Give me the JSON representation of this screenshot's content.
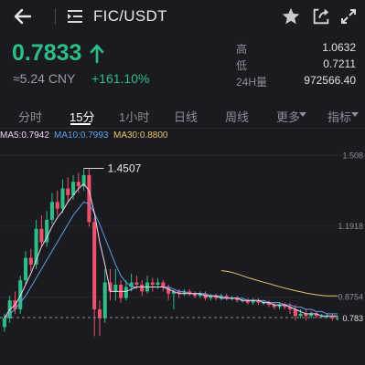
{
  "header": {
    "pair": "FIC/USDT",
    "icons": [
      "back-arrow-icon",
      "menu-list-icon",
      "star-icon",
      "share-icon",
      "expand-icon"
    ]
  },
  "ticker": {
    "price": "0.7833",
    "cny": "≈5.24 CNY",
    "change": "+161.10%",
    "stats": [
      {
        "label": "高",
        "value": "1.0632"
      },
      {
        "label": "低",
        "value": "0.7211"
      },
      {
        "label": "24H量",
        "value": "972566.40"
      }
    ]
  },
  "tabs": {
    "items": [
      "分时",
      "15分",
      "1小时",
      "日线",
      "周线",
      "更多",
      "指标"
    ],
    "active": "15分"
  },
  "ma": {
    "ma5": "MA5:0.7942",
    "ma10": "MA10:0.7993",
    "ma30": "MA30:0.8800"
  },
  "colors": {
    "up": "#2dbd85",
    "down": "#f0516b",
    "ma5": "#f4d3f2",
    "ma10": "#5ea0e6",
    "ma30": "#e7c36b",
    "background": "#1a1b20"
  },
  "chart_data": {
    "type": "candlestick",
    "y_ticks": [
      "1.508",
      "1.1918",
      "0.8754",
      "0.783"
    ],
    "annotations": {
      "high": "1.4507",
      "last": "0.783"
    },
    "ylim": [
      0.62,
      1.55
    ],
    "candles": [
      [
        0.74,
        0.78,
        0.72,
        0.8
      ],
      [
        0.78,
        0.86,
        0.76,
        0.88
      ],
      [
        0.86,
        0.82,
        0.8,
        0.9
      ],
      [
        0.82,
        0.95,
        0.8,
        0.97
      ],
      [
        0.95,
        1.05,
        0.93,
        1.08
      ],
      [
        1.05,
        1.02,
        0.99,
        1.09
      ],
      [
        1.02,
        1.18,
        1.0,
        1.22
      ],
      [
        1.18,
        1.12,
        1.1,
        1.24
      ],
      [
        1.12,
        1.22,
        1.1,
        1.26
      ],
      [
        1.22,
        1.3,
        1.2,
        1.34
      ],
      [
        1.3,
        1.27,
        1.24,
        1.35
      ],
      [
        1.27,
        1.36,
        1.25,
        1.4
      ],
      [
        1.36,
        1.33,
        1.3,
        1.41
      ],
      [
        1.33,
        1.39,
        1.31,
        1.42
      ],
      [
        1.39,
        1.37,
        1.34,
        1.43
      ],
      [
        1.37,
        1.42,
        1.35,
        1.45
      ],
      [
        1.42,
        1.21,
        1.19,
        1.45
      ],
      [
        1.21,
        0.82,
        0.7,
        1.23
      ],
      [
        0.82,
        0.78,
        0.7,
        0.86
      ],
      [
        0.78,
        0.94,
        0.76,
        1.0
      ],
      [
        0.94,
        0.9,
        0.86,
        1.0
      ],
      [
        0.9,
        0.93,
        0.86,
        1.0
      ],
      [
        0.93,
        0.87,
        0.85,
        0.95
      ],
      [
        0.87,
        0.92,
        0.86,
        0.95
      ],
      [
        0.92,
        0.94,
        0.9,
        0.98
      ],
      [
        0.94,
        0.93,
        0.91,
        0.97
      ],
      [
        0.93,
        0.9,
        0.88,
        0.95
      ],
      [
        0.9,
        0.94,
        0.89,
        0.97
      ],
      [
        0.94,
        0.93,
        0.9,
        0.96
      ],
      [
        0.93,
        0.94,
        0.91,
        0.96
      ],
      [
        0.94,
        0.92,
        0.9,
        0.95
      ],
      [
        0.92,
        0.89,
        0.86,
        0.93
      ],
      [
        0.89,
        0.9,
        0.82,
        0.91
      ],
      [
        0.9,
        0.89,
        0.87,
        0.91
      ],
      [
        0.89,
        0.9,
        0.88,
        0.91
      ],
      [
        0.9,
        0.89,
        0.88,
        0.91
      ],
      [
        0.89,
        0.88,
        0.87,
        0.9
      ],
      [
        0.88,
        0.89,
        0.87,
        0.9
      ],
      [
        0.89,
        0.87,
        0.86,
        0.9
      ],
      [
        0.87,
        0.88,
        0.86,
        0.89
      ],
      [
        0.88,
        0.87,
        0.86,
        0.89
      ],
      [
        0.87,
        0.88,
        0.86,
        0.89
      ],
      [
        0.88,
        0.87,
        0.86,
        0.89
      ],
      [
        0.87,
        0.87,
        0.86,
        0.88
      ],
      [
        0.87,
        0.86,
        0.85,
        0.88
      ],
      [
        0.86,
        0.86,
        0.85,
        0.87
      ],
      [
        0.86,
        0.85,
        0.84,
        0.87
      ],
      [
        0.85,
        0.86,
        0.84,
        0.87
      ],
      [
        0.86,
        0.85,
        0.84,
        0.87
      ],
      [
        0.85,
        0.85,
        0.84,
        0.86
      ],
      [
        0.85,
        0.84,
        0.83,
        0.86
      ],
      [
        0.84,
        0.83,
        0.82,
        0.85
      ],
      [
        0.83,
        0.84,
        0.82,
        0.85
      ],
      [
        0.84,
        0.83,
        0.82,
        0.85
      ],
      [
        0.83,
        0.82,
        0.8,
        0.85
      ],
      [
        0.82,
        0.79,
        0.77,
        0.84
      ],
      [
        0.79,
        0.8,
        0.78,
        0.82
      ],
      [
        0.8,
        0.79,
        0.77,
        0.82
      ],
      [
        0.79,
        0.8,
        0.78,
        0.81
      ],
      [
        0.8,
        0.79,
        0.78,
        0.81
      ],
      [
        0.79,
        0.79,
        0.78,
        0.8
      ],
      [
        0.79,
        0.79,
        0.78,
        0.8
      ],
      [
        0.79,
        0.78,
        0.77,
        0.8
      ],
      [
        0.78,
        0.78,
        0.77,
        0.79
      ]
    ],
    "ma5": [
      0.78,
      0.82,
      0.84,
      0.88,
      0.93,
      0.98,
      1.04,
      1.1,
      1.14,
      1.19,
      1.23,
      1.26,
      1.3,
      1.33,
      1.36,
      1.38,
      1.35,
      1.25,
      1.12,
      1.02,
      0.9,
      0.9,
      0.9,
      0.9,
      0.91,
      0.92,
      0.92,
      0.92,
      0.92,
      0.92,
      0.92,
      0.91,
      0.9,
      0.89,
      0.89,
      0.89,
      0.89,
      0.89,
      0.88,
      0.88,
      0.88,
      0.87,
      0.87,
      0.87,
      0.87,
      0.86,
      0.86,
      0.86,
      0.86,
      0.85,
      0.85,
      0.84,
      0.84,
      0.84,
      0.83,
      0.82,
      0.81,
      0.8,
      0.8,
      0.8,
      0.79,
      0.79,
      0.79,
      0.79
    ],
    "ma10": [
      0.78,
      0.8,
      0.82,
      0.85,
      0.88,
      0.92,
      0.96,
      1.0,
      1.04,
      1.08,
      1.12,
      1.16,
      1.2,
      1.24,
      1.27,
      1.3,
      1.29,
      1.25,
      1.2,
      1.14,
      1.08,
      1.02,
      0.97,
      0.94,
      0.92,
      0.92,
      0.92,
      0.92,
      0.92,
      0.92,
      0.92,
      0.92,
      0.91,
      0.9,
      0.9,
      0.89,
      0.89,
      0.89,
      0.89,
      0.88,
      0.88,
      0.88,
      0.87,
      0.87,
      0.87,
      0.87,
      0.86,
      0.86,
      0.86,
      0.86,
      0.85,
      0.85,
      0.85,
      0.84,
      0.84,
      0.83,
      0.83,
      0.82,
      0.82,
      0.81,
      0.81,
      0.8,
      0.8,
      0.8
    ],
    "ma30": [
      null,
      null,
      null,
      null,
      null,
      null,
      null,
      null,
      null,
      null,
      null,
      null,
      null,
      null,
      null,
      null,
      null,
      null,
      null,
      null,
      null,
      null,
      null,
      null,
      null,
      null,
      null,
      null,
      null,
      null,
      null,
      null,
      null,
      null,
      null,
      null,
      null,
      null,
      null,
      null,
      null,
      0.993,
      0.99,
      0.985,
      0.978,
      0.97,
      0.962,
      0.955,
      0.948,
      0.941,
      0.935,
      0.928,
      0.921,
      0.915,
      0.909,
      0.903,
      0.898,
      0.893,
      0.889,
      0.885,
      0.882,
      0.88,
      0.88,
      0.88
    ]
  }
}
